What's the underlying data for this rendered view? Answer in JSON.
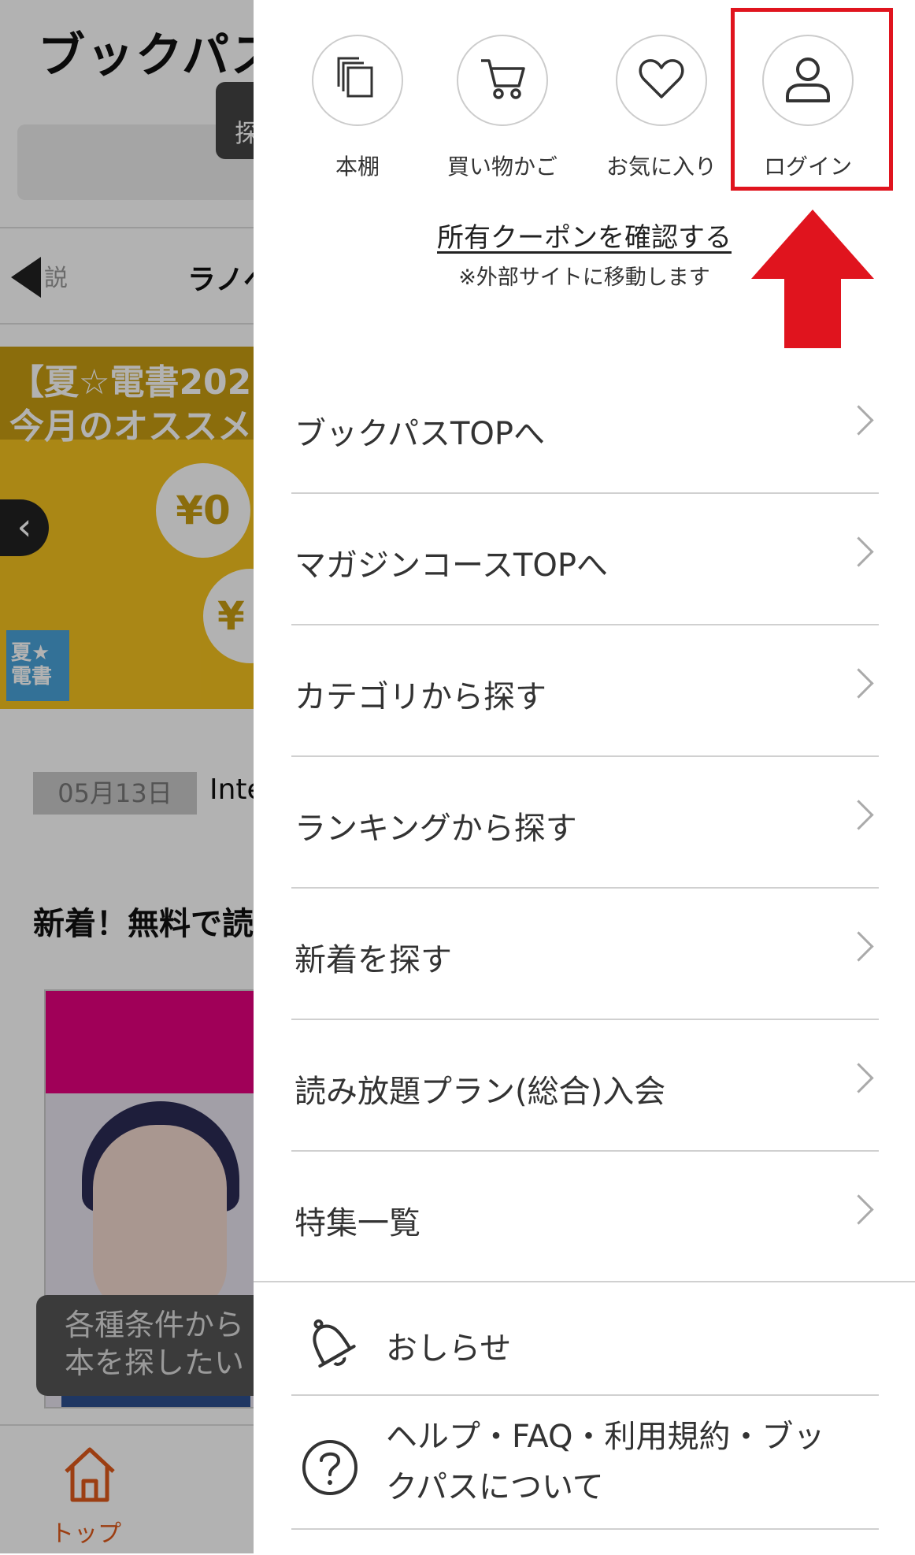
{
  "background": {
    "app_title": "ブックパス",
    "search_button": "探",
    "tab_prev": "説",
    "tab_current": "ラノベ",
    "banner_text": "【夏☆電書202\n今月のオススメ",
    "banner_coin": "¥0",
    "banner_coin2": "¥",
    "banner_badge": "夏★\n電書",
    "news_date": "05月13日",
    "news_text": "Inte",
    "section_title": "新着！無料で読",
    "tooltip": "各種条件から\n本を探したい",
    "bottom_nav_home": "トップ"
  },
  "drawer": {
    "top_icons": [
      {
        "label": "本棚",
        "icon": "bookshelf-icon"
      },
      {
        "label": "買い物かご",
        "icon": "cart-icon"
      },
      {
        "label": "お気に入り",
        "icon": "heart-icon"
      },
      {
        "label": "ログイン",
        "icon": "user-icon"
      }
    ],
    "coupon_link": "所有クーポンを確認する",
    "coupon_note": "※外部サイトに移動します",
    "menu_items": [
      "ブックパスTOPへ",
      "マガジンコースTOPへ",
      "カテゴリから探す",
      "ランキングから探す",
      "新着を探す",
      "読み放題プラン(総合)入会",
      "特集一覧"
    ],
    "notice": "おしらせ",
    "help": "ヘルプ・FAQ・利用規約・ブッ\nクパスについて"
  },
  "annotation": {
    "highlight_color": "#e0141e"
  }
}
